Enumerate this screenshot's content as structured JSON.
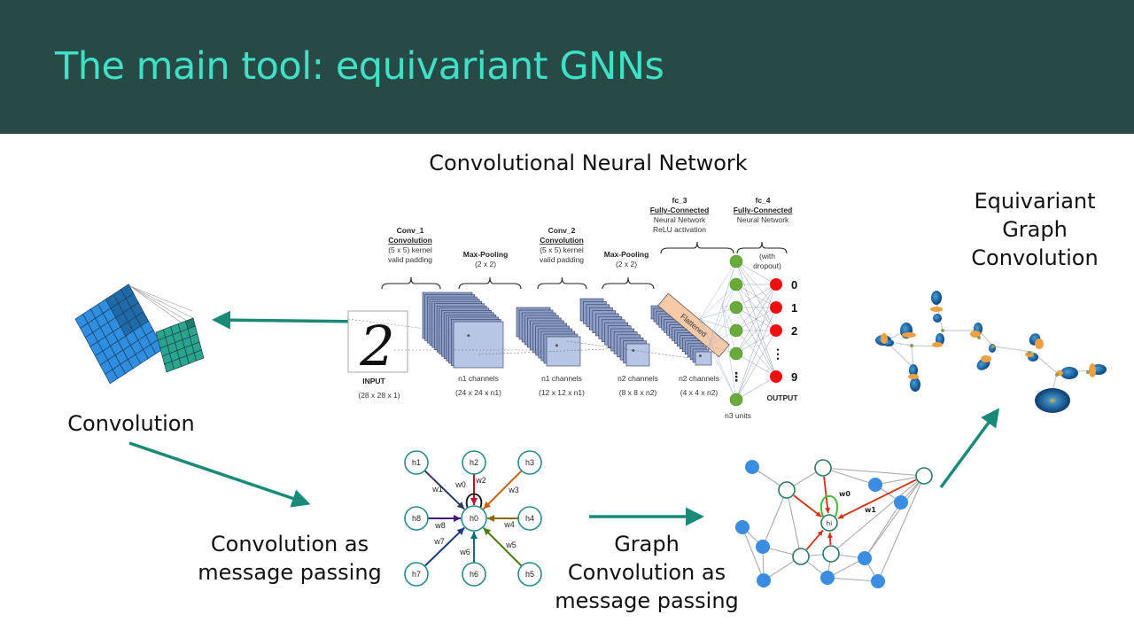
{
  "slide": {
    "title": "The main tool: equivariant GNNs",
    "header_color": "#284a47",
    "title_color": "#3fe0c5",
    "arrow_color": "#1a8a78"
  },
  "labels": {
    "cnn": "Convolutional Neural Network",
    "equivariant": [
      "Equivariant",
      "Graph",
      "Convolution"
    ],
    "convolution": "Convolution",
    "conv_mp": [
      "Convolution as",
      "message passing"
    ],
    "graph_conv_mp": [
      "Graph",
      "Convolution as",
      "message passing"
    ]
  },
  "cnn_diagram": {
    "conv1": [
      "Conv_1",
      "Convolution",
      "(5 x 5) kernel",
      "valid padding"
    ],
    "pool1": [
      "Max-Pooling",
      "(2 x 2)"
    ],
    "conv2": [
      "Conv_2",
      "Convolution",
      "(5 x 5) kernel",
      "valid padding"
    ],
    "pool2": [
      "Max-Pooling",
      "(2 x 2)"
    ],
    "fc3": [
      "fc_3",
      "Fully-Connected",
      "Neural Network",
      "ReLU activation"
    ],
    "fc4": [
      "fc_4",
      "Fully-Connected",
      "Neural Network"
    ],
    "dropout": [
      "(with",
      "dropout)"
    ],
    "flattened": "Flattened",
    "input": [
      "INPUT",
      "(28 x 28 x 1)"
    ],
    "layers": [
      [
        "n1 channels",
        "(24 x 24 x n1)"
      ],
      [
        "n1 channels",
        "(12 x 12 x n1)"
      ],
      [
        "n2 channels",
        "(8 x 8 x n2)"
      ],
      [
        "n2 channels",
        "(4 x 4 x n2)"
      ]
    ],
    "hidden": "n3 units",
    "output_label": "OUTPUT",
    "outputs": [
      "0",
      "1",
      "2",
      "⋮",
      "9"
    ],
    "input_digit": "2"
  },
  "message_passing": {
    "center": "h0",
    "neighbors": [
      "h1",
      "h2",
      "h3",
      "h4",
      "h5",
      "h6",
      "h7",
      "h8"
    ],
    "weights": [
      "w0",
      "w1",
      "w2",
      "w3",
      "w4",
      "w5",
      "w6",
      "w7",
      "w8"
    ],
    "colors": [
      "#2d3a5a",
      "#c0102a",
      "#d06010",
      "#8a6a10",
      "#4a7a10",
      "#107070",
      "#1a3a7a",
      "#4a1a7a"
    ]
  },
  "graph_mp": {
    "center": "hi",
    "weights": [
      "w0",
      "w1"
    ],
    "node_color": "#3a8de0",
    "edge_color": "#d03010",
    "self_loop_color": "#40c030"
  }
}
